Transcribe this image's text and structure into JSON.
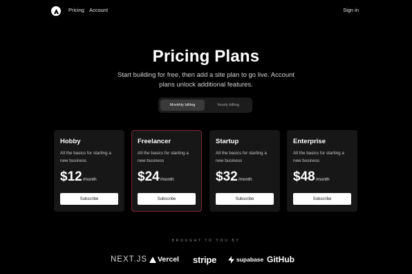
{
  "nav": {
    "links": [
      "Pricing",
      "Account"
    ],
    "signin": "Sign in"
  },
  "header": {
    "title": "Pricing Plans",
    "subtitle": "Start building for free, then add a site plan to go live. Account plans unlock additional features."
  },
  "billing": {
    "monthly": "Monthly billing",
    "yearly": "Yearly billing",
    "selected": "Monthly billing"
  },
  "plans": [
    {
      "name": "Hobby",
      "description": "All the basics for starting a new business",
      "price": "$12",
      "period": "/month",
      "cta": "Subscribe"
    },
    {
      "name": "Freelancer",
      "description": "All the basics for starting a new business",
      "price": "$24",
      "period": "/month",
      "cta": "Subscribe"
    },
    {
      "name": "Startup",
      "description": "All the basics for starting a new business",
      "price": "$32",
      "period": "/month",
      "cta": "Subscribe"
    },
    {
      "name": "Enterprise",
      "description": "All the basics for starting a new business",
      "price": "$48",
      "period": "/month",
      "cta": "Subscribe"
    }
  ],
  "sponsors": {
    "heading": "BROUGHT TO YOU BY",
    "brands": [
      "NEXT.JS",
      "Vercel",
      "stripe",
      "supabase",
      "GitHub"
    ]
  },
  "colors": {
    "background": "#000000",
    "card": "#171717",
    "highlight_border": "#7f2436"
  }
}
